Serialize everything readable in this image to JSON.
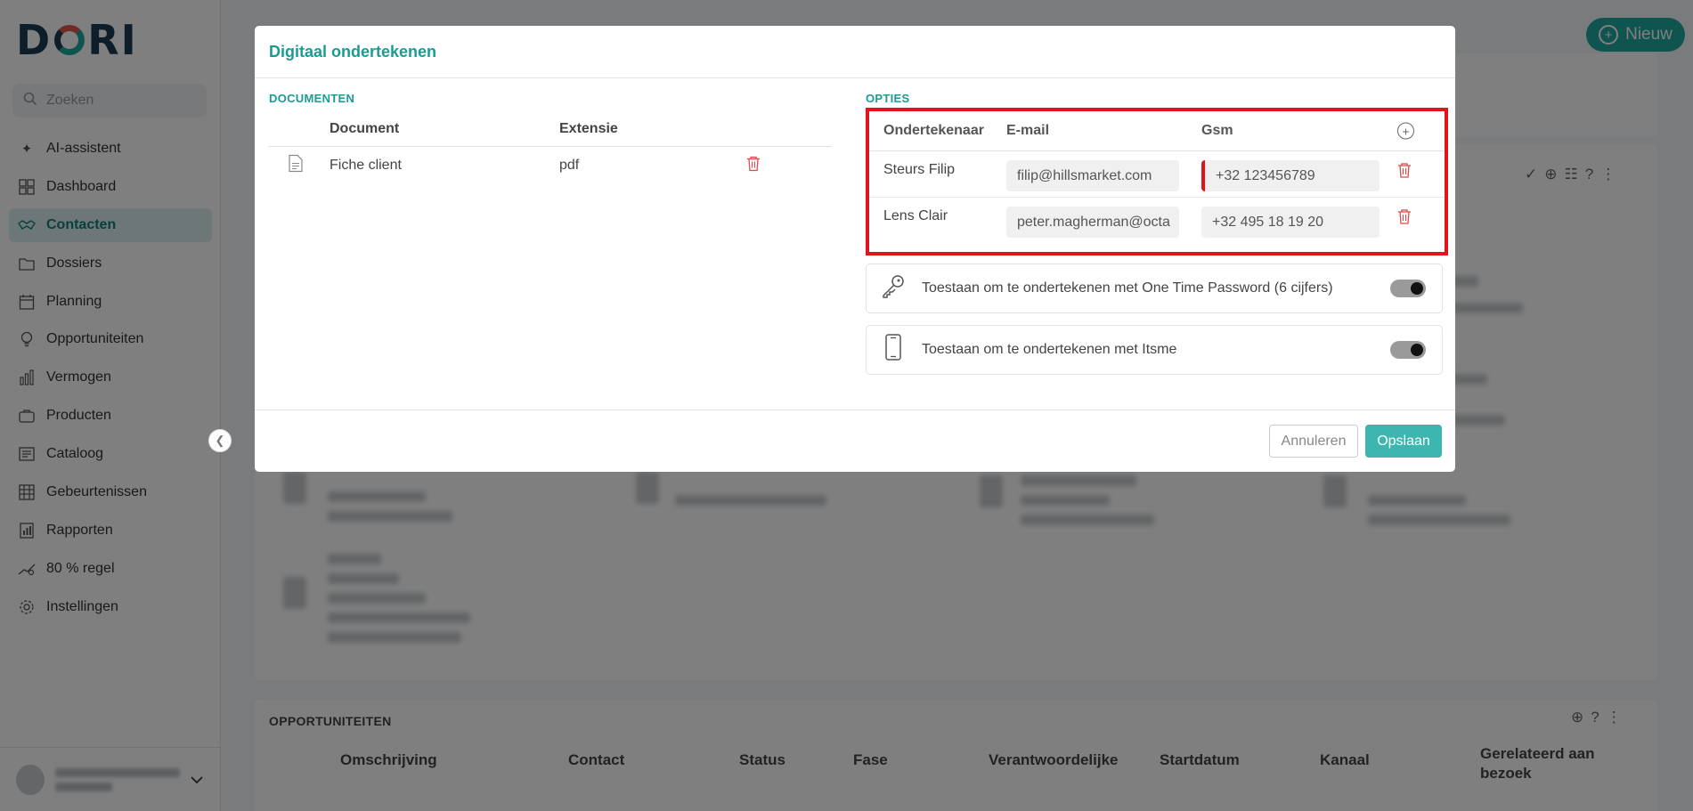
{
  "app": {
    "logo": "DORI"
  },
  "sidebar": {
    "search_placeholder": "Zoeken",
    "items": [
      {
        "label": "AI-assistent",
        "icon": "sparkle-icon",
        "active": false
      },
      {
        "label": "Dashboard",
        "icon": "dashboard-icon",
        "active": false
      },
      {
        "label": "Contacten",
        "icon": "handshake-icon",
        "active": true
      },
      {
        "label": "Dossiers",
        "icon": "folder-icon",
        "active": false
      },
      {
        "label": "Planning",
        "icon": "calendar-icon",
        "active": false
      },
      {
        "label": "Opportuniteiten",
        "icon": "lightbulb-icon",
        "active": false
      },
      {
        "label": "Vermogen",
        "icon": "chart-icon",
        "active": false
      },
      {
        "label": "Producten",
        "icon": "briefcase-icon",
        "active": false
      },
      {
        "label": "Cataloog",
        "icon": "catalog-icon",
        "active": false
      },
      {
        "label": "Gebeurtenissen",
        "icon": "events-icon",
        "active": false
      },
      {
        "label": "Rapporten",
        "icon": "report-icon",
        "active": false
      },
      {
        "label": "80 % regel",
        "icon": "rule-icon",
        "active": false
      },
      {
        "label": "Instellingen",
        "icon": "gear-icon",
        "active": false
      }
    ]
  },
  "header": {
    "new_label": "Nieuw"
  },
  "background": {
    "opportunities_title": "OPPORTUNITEITEN",
    "columns": [
      "Omschrijving",
      "Contact",
      "Status",
      "Fase",
      "Verantwoordelijke",
      "Startdatum",
      "Kanaal",
      "Gerelateerd aan bezoek"
    ]
  },
  "modal": {
    "title": "Digitaal ondertekenen",
    "documents": {
      "section_title": "DOCUMENTEN",
      "col_document": "Document",
      "col_extension": "Extensie",
      "rows": [
        {
          "name": "Fiche client",
          "extension": "pdf"
        }
      ]
    },
    "options": {
      "section_title": "OPTIES",
      "col_signer": "Ondertekenaar",
      "col_email": "E-mail",
      "col_gsm": "Gsm",
      "signers": [
        {
          "name": "Steurs Filip",
          "email": "filip@hillsmarket.com",
          "gsm": "+32 123456789",
          "gsm_invalid": true
        },
        {
          "name": "Lens Clair",
          "email": "peter.magherman@octa",
          "gsm": "+32 495 18 19 20",
          "gsm_invalid": false
        }
      ],
      "otp_label": "Toestaan om te ondertekenen met One Time Password (6 cijfers)",
      "otp_enabled": true,
      "itsme_label": "Toestaan om te ondertekenen met Itsme",
      "itsme_enabled": true
    },
    "cancel_label": "Annuleren",
    "save_label": "Opslaan"
  }
}
